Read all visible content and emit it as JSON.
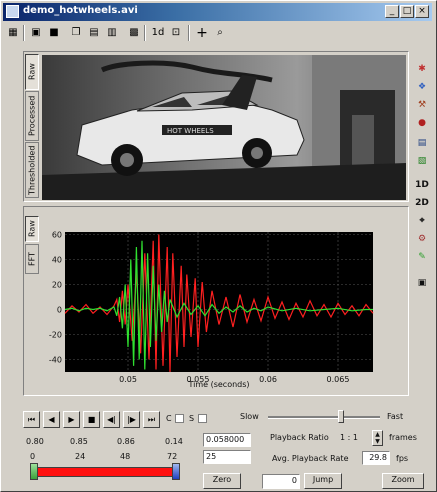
{
  "window": {
    "title": "demo_hotwheels.avi",
    "controls": [
      "_",
      "□",
      "×"
    ]
  },
  "toolbar": {
    "icons": [
      "film-icon",
      "record-icon",
      "stop-icon",
      "copy-icon",
      "grid-icon",
      "grid-alt-icon",
      "save-icon",
      "mode-1d-icon",
      "expand-icon",
      "crosshair-icon",
      "zoom-icon"
    ],
    "label_1d": "1d",
    "crosshair": "+",
    "zoom": "⌕"
  },
  "video_tabs": [
    "Raw",
    "Processed",
    "Thresholded"
  ],
  "plot_tabs": [
    "Raw",
    "FFT"
  ],
  "right_toolbar": {
    "label_1d": "1D",
    "label_2d": "2D"
  },
  "chart_data": {
    "type": "line",
    "xlabel": "Time (seconds)",
    "ylabel": "",
    "x_ticks": [
      "0.05",
      "0.055",
      "0.06",
      "0.065"
    ],
    "y_ticks": [
      "60",
      "40",
      "20",
      "0",
      "-20",
      "-40"
    ],
    "xlim": [
      0.0455,
      0.0675
    ],
    "ylim": [
      -50,
      62
    ],
    "grid": true,
    "background": "#000000",
    "series": [
      {
        "color": "#ff2020",
        "x": [
          0.0455,
          0.046,
          0.0465,
          0.047,
          0.0475,
          0.048,
          0.0485,
          0.049,
          0.0492,
          0.0494,
          0.0496,
          0.0498,
          0.05,
          0.0503,
          0.0506,
          0.0509,
          0.0512,
          0.0515,
          0.0518,
          0.052,
          0.0522,
          0.0525,
          0.0528,
          0.053,
          0.0532,
          0.0535,
          0.0538,
          0.054,
          0.0542,
          0.0545,
          0.0548,
          0.055,
          0.0553,
          0.0556,
          0.056,
          0.0565,
          0.057,
          0.0575,
          0.058,
          0.0585,
          0.059,
          0.0595,
          0.06,
          0.0605,
          0.061,
          0.0615,
          0.062,
          0.0625,
          0.063,
          0.0635,
          0.064,
          0.0645,
          0.065,
          0.0655,
          0.066,
          0.0665,
          0.067,
          0.0675
        ],
        "y": [
          -3,
          3,
          -2,
          4,
          -3,
          2,
          -4,
          3,
          8,
          -10,
          15,
          -12,
          20,
          -25,
          30,
          -35,
          45,
          -40,
          55,
          -48,
          60,
          -45,
          50,
          -50,
          45,
          -38,
          35,
          -30,
          28,
          -22,
          25,
          -30,
          22,
          -18,
          15,
          -12,
          10,
          -14,
          12,
          -10,
          8,
          -9,
          10,
          -7,
          6,
          -8,
          5,
          -6,
          7,
          -5,
          4,
          -6,
          5,
          -4,
          3,
          -5,
          4,
          -3
        ]
      },
      {
        "color": "#30e030",
        "x": [
          0.0455,
          0.046,
          0.0465,
          0.047,
          0.0475,
          0.048,
          0.0485,
          0.049,
          0.0492,
          0.0494,
          0.0496,
          0.0498,
          0.05,
          0.0502,
          0.0504,
          0.0506,
          0.0508,
          0.051,
          0.0512,
          0.0514,
          0.0516,
          0.0518,
          0.052,
          0.0522,
          0.0524,
          0.0526,
          0.0528,
          0.053,
          0.0535,
          0.054,
          0.0545,
          0.055,
          0.0555,
          0.056,
          0.0565,
          0.057,
          0.0575,
          0.058,
          0.0585,
          0.059,
          0.0595,
          0.06,
          0.061,
          0.062,
          0.063,
          0.064,
          0.065,
          0.066,
          0.067,
          0.0675
        ],
        "y": [
          0,
          1,
          -1,
          1,
          0,
          1,
          -1,
          2,
          -5,
          10,
          -15,
          20,
          -30,
          40,
          -45,
          50,
          -40,
          55,
          -48,
          45,
          -30,
          35,
          -25,
          20,
          -18,
          15,
          -10,
          8,
          -6,
          5,
          -4,
          3,
          -5,
          4,
          -3,
          2,
          -2,
          3,
          -2,
          1,
          -1,
          2,
          -1,
          1,
          -1,
          0,
          1,
          -1,
          0,
          0
        ]
      }
    ]
  },
  "transport": {
    "buttons": [
      "⏮",
      "◀",
      "▶",
      "■",
      "◀|",
      "|▶",
      "⏭"
    ],
    "c_label": "C",
    "s_label": "S",
    "slow_label": "Slow",
    "fast_label": "Fast",
    "speed_fraction": 0.65,
    "time_ticks": [
      "0.80",
      "0.85",
      "0.86",
      "0.14"
    ],
    "frame_ticks": [
      "0",
      "24",
      "48",
      "72"
    ],
    "time_value": "0.058000",
    "frame_value": "25",
    "playback_ratio_label": "Playback Ratio",
    "playback_ratio_value": "1 : 1",
    "frames_label": "frames",
    "avg_rate_label": "Avg. Playback Rate",
    "avg_rate_value": "29.8",
    "fps_label": "fps",
    "zero_label": "Zero",
    "jump_value": "0",
    "jump_label": "Jump",
    "zoom_label": "Zoom"
  }
}
